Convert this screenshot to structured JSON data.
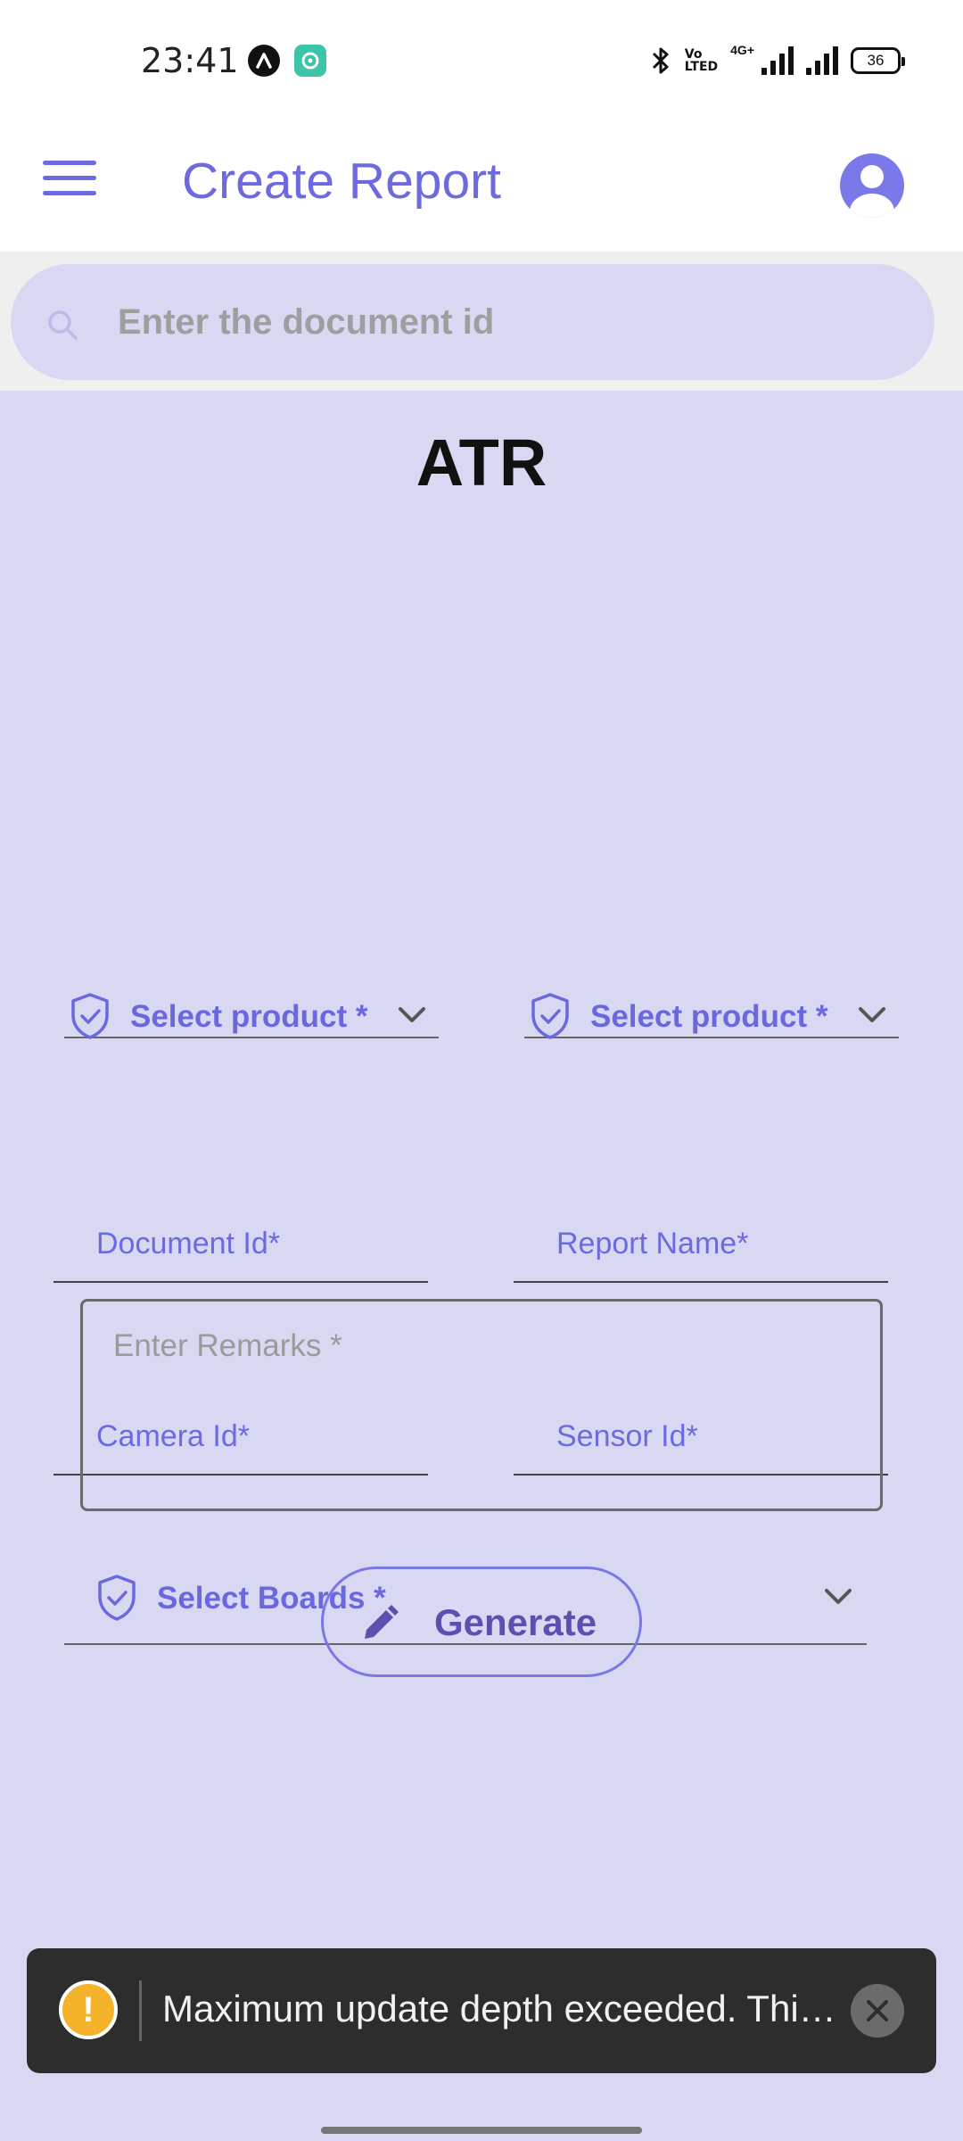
{
  "status_bar": {
    "time": "23:41",
    "volte_top": "Vo",
    "volte_bottom": "LTED",
    "network": "4G+",
    "battery": "36",
    "icons": [
      "app-icon-a",
      "app-icon-chat",
      "bluetooth-icon",
      "volte-icon",
      "signal-icon",
      "signal-icon",
      "battery-icon"
    ]
  },
  "appbar": {
    "title": "Create Report",
    "menu_icon": "hamburger-menu-icon",
    "profile_icon": "account-circle-icon"
  },
  "search": {
    "placeholder": "Enter the document id",
    "icon": "search-icon"
  },
  "form": {
    "title": "ATR",
    "product_select_1": "Select product *",
    "product_select_2": "Select product *",
    "document_id_placeholder": "Document Id*",
    "report_name_placeholder": "Report Name*",
    "camera_id_placeholder": "Camera Id*",
    "sensor_id_placeholder": "Sensor Id*",
    "boards_select": "Select Boards *",
    "remarks_placeholder": "Enter Remarks *",
    "generate_label": "Generate"
  },
  "toast": {
    "message": "Maximum update depth exceeded. Thi…",
    "icon": "warning-icon",
    "icon_glyph": "!"
  },
  "colors": {
    "accent": "#6d6ae0",
    "background": "#d9d8f3",
    "toast_background": "#2d2d2d",
    "warning": "#f5b32c"
  }
}
